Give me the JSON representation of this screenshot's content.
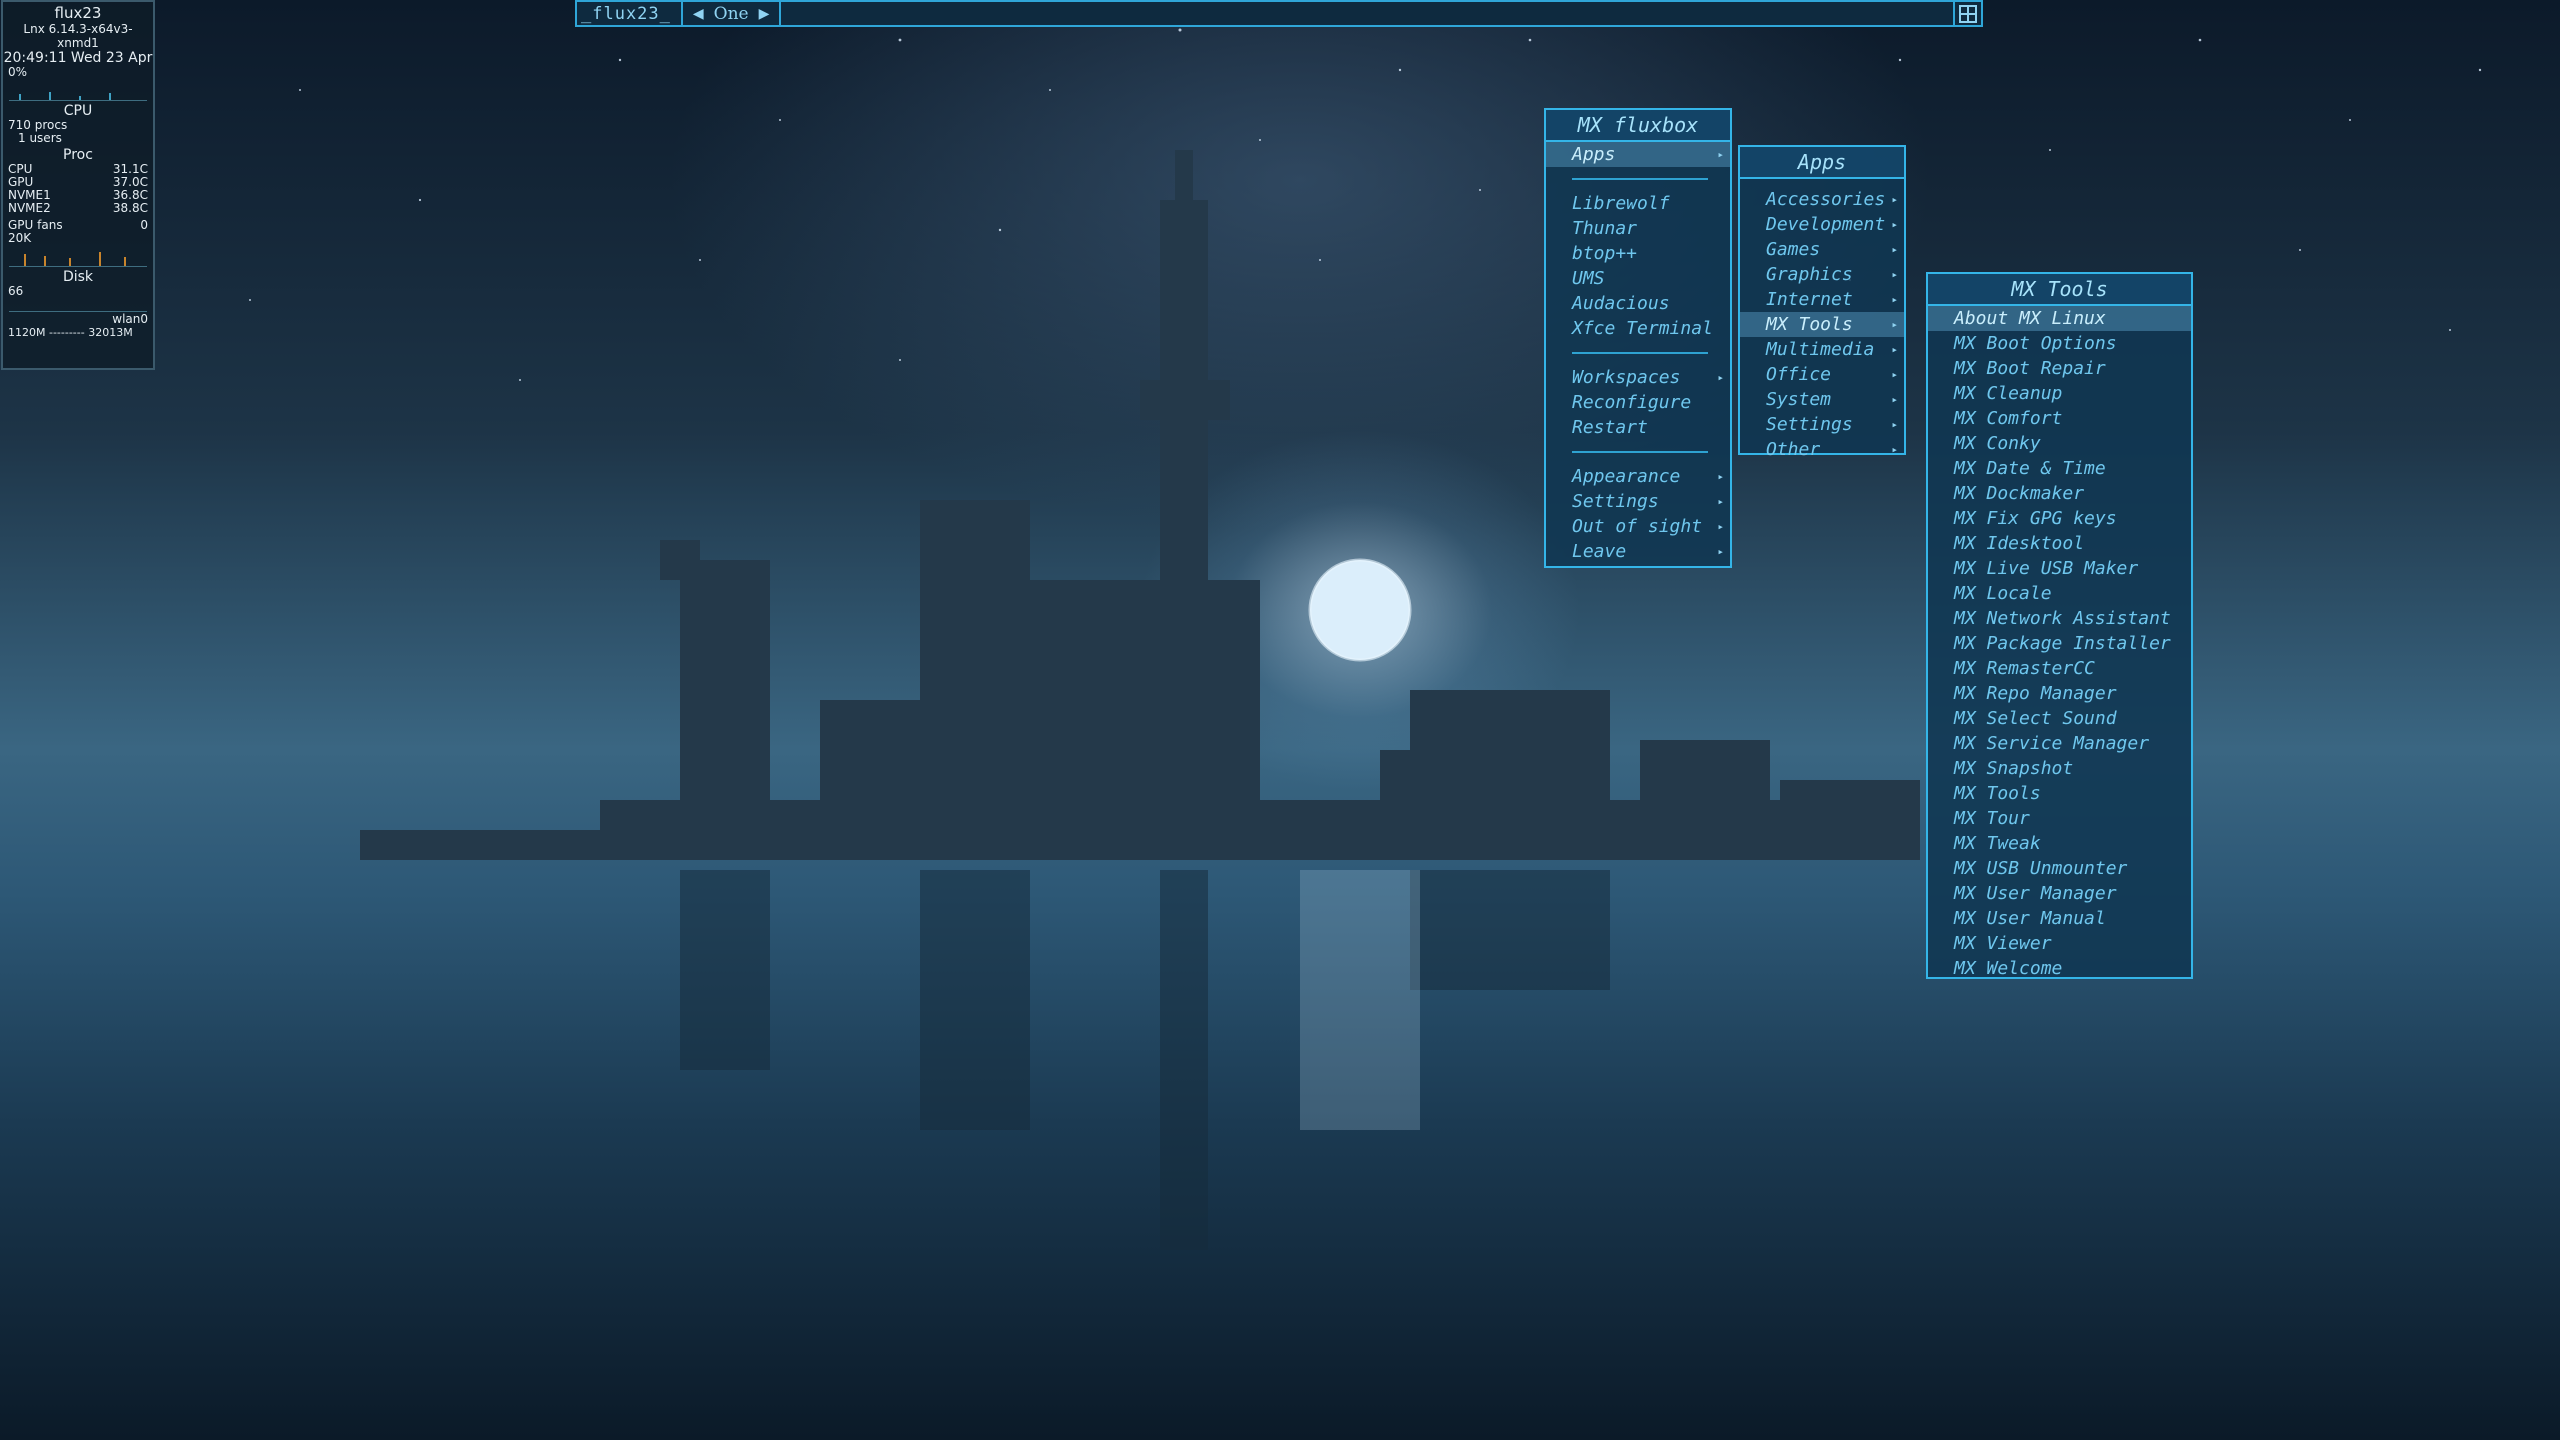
{
  "toolbar": {
    "name": "_flux23_",
    "workspace": "One",
    "prev_arrow": "◀",
    "next_arrow": "▶"
  },
  "conky": {
    "host": "flux23",
    "kernel": "Lnx 6.14.3-x64v3-xnmd1",
    "datetime": "20:49:11  Wed 23 Apr",
    "cpu_pct": "0%",
    "cpu_label": "CPU",
    "procs": "710 procs",
    "users": "1 users",
    "proc_label": "Proc",
    "temps": [
      {
        "label": "CPU",
        "value": "31.1C"
      },
      {
        "label": "GPU",
        "value": "37.0C"
      },
      {
        "label": "NVME1",
        "value": "36.8C"
      },
      {
        "label": "NVME2",
        "value": "38.8C"
      }
    ],
    "gpu_fans_label": "GPU fans",
    "gpu_fans_value": "0",
    "proc_scale": "20K",
    "disk_label": "Disk",
    "disk_value": "66",
    "net_iface": "wlan0",
    "net_line": "1120M --------- 32013M"
  },
  "root_menu": {
    "title": "MX fluxbox",
    "apps": "Apps",
    "launchers": [
      "Librewolf",
      "Thunar",
      "btop++",
      "UMS",
      "Audacious",
      "Xfce Terminal"
    ],
    "system": [
      "Workspaces",
      "Reconfigure",
      "Restart"
    ],
    "system_sub": [
      true,
      false,
      false
    ],
    "bottom": [
      "Appearance",
      "Settings",
      "Out of sight",
      "Leave"
    ]
  },
  "apps_menu": {
    "title": "Apps",
    "items": [
      "Accessories",
      "Development",
      "Games",
      "Graphics",
      "Internet",
      "MX Tools",
      "Multimedia",
      "Office",
      "System",
      "Settings",
      "Other"
    ],
    "highlighted": "MX Tools"
  },
  "mxtools_menu": {
    "title": "MX Tools",
    "items": [
      "About MX Linux",
      "MX Boot Options",
      "MX Boot Repair",
      "MX Cleanup",
      "MX Comfort",
      "MX Conky",
      "MX Date & Time",
      "MX Dockmaker",
      "MX Fix GPG keys",
      "MX Idesktool",
      "MX Live USB Maker",
      "MX Locale",
      "MX Network Assistant",
      "MX Package Installer",
      "MX RemasterCC",
      "MX Repo Manager",
      "MX Select Sound",
      "MX Service Manager",
      "MX Snapshot",
      "MX Tools",
      "MX Tour",
      "MX Tweak",
      "MX USB Unmounter",
      "MX User Manager",
      "MX User Manual",
      "MX Viewer",
      "MX Welcome"
    ],
    "highlighted": "About MX Linux"
  },
  "colors": {
    "accent": "#34b5e8",
    "menu_text": "#6fc7ee",
    "menu_bg": "#103752"
  }
}
